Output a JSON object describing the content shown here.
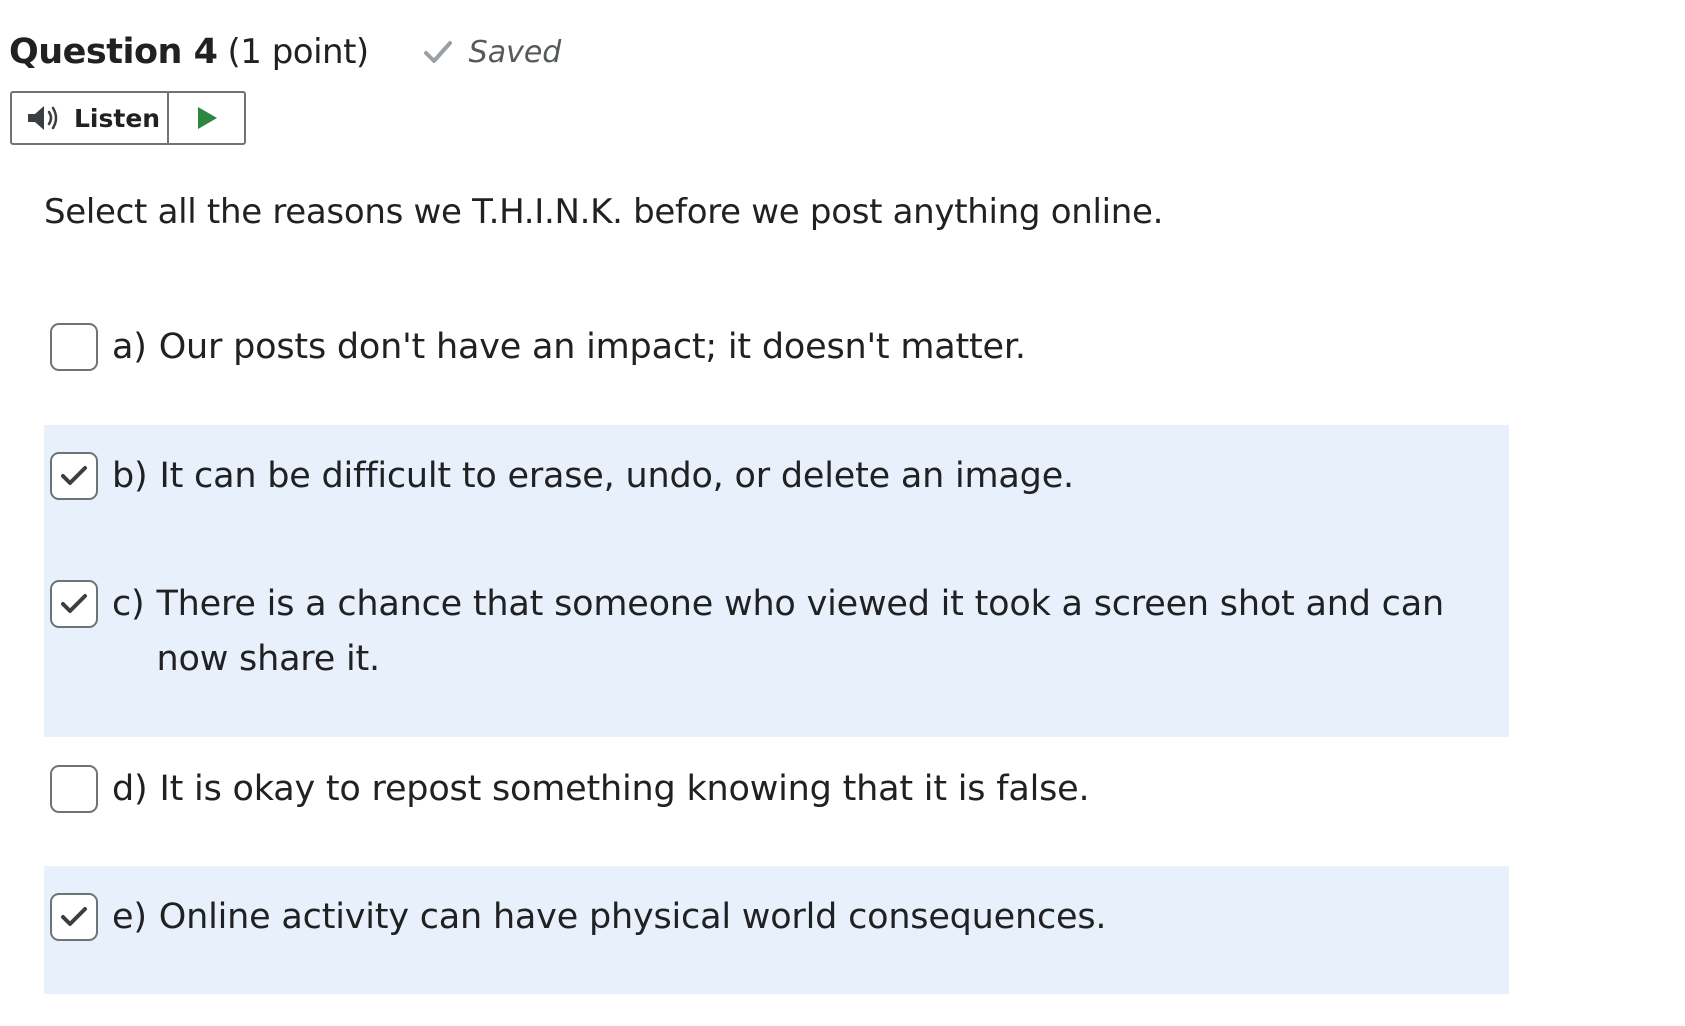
{
  "question": {
    "title": "Question 4",
    "points": "(1 point)",
    "status": "Saved",
    "status_icon": "checkmark-icon"
  },
  "listen": {
    "label": "Listen",
    "speaker_icon": "speaker-icon",
    "play_icon": "play-icon",
    "play_color": "#2e8540"
  },
  "prompt": "Select all the reasons we T.H.I.N.K. before we post anything online.",
  "options": [
    {
      "letter": "a)",
      "text": "Our posts don't have an impact; it doesn't matter.",
      "checked": false
    },
    {
      "letter": "b)",
      "text": "It can be difficult to erase, undo, or delete an image.",
      "checked": true
    },
    {
      "letter": "c)",
      "text": "There is a chance that someone who viewed it took a screen shot and can now share it.",
      "checked": true
    },
    {
      "letter": "d)",
      "text": "It is okay to repost something knowing that it is false.",
      "checked": false
    },
    {
      "letter": "e)",
      "text": "Online activity can have physical world consequences.",
      "checked": true
    }
  ],
  "colors": {
    "selected_background": "#e8f1fb",
    "text": "#202122",
    "border": "#6e7376"
  }
}
